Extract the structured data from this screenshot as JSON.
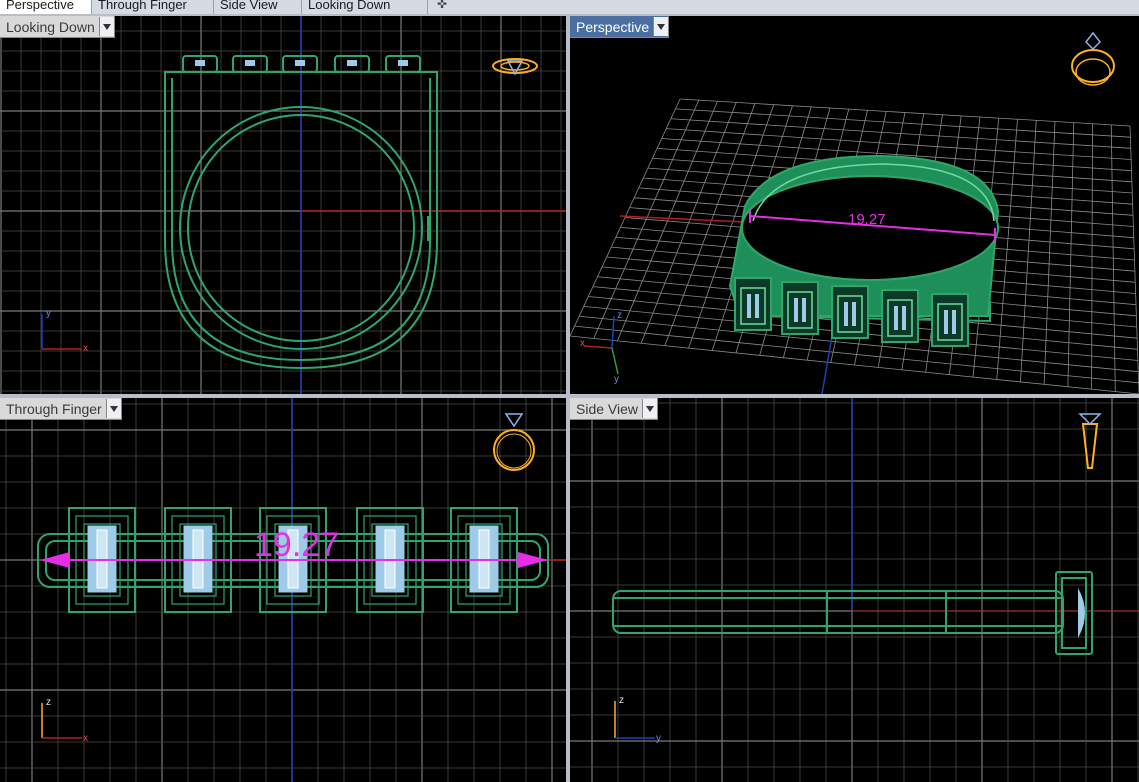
{
  "tabs": [
    {
      "label": "Perspective",
      "active": true
    },
    {
      "label": "Through Finger",
      "active": false
    },
    {
      "label": "Side View",
      "active": false
    },
    {
      "label": "Looking Down",
      "active": false
    }
  ],
  "add_tab_icon": "plus-icon",
  "viewports": {
    "top_left": {
      "title": "Looking Down",
      "axes": [
        "y",
        "x"
      ]
    },
    "top_right": {
      "title": "Perspective",
      "dimension": "19.27",
      "axes": [
        "z",
        "x",
        "y"
      ]
    },
    "bottom_left": {
      "title": "Through Finger",
      "dimension": "19.27",
      "axes": [
        "z",
        "x"
      ]
    },
    "bottom_right": {
      "title": "Side View",
      "axes": [
        "z",
        "y"
      ]
    }
  },
  "colors": {
    "model_green": "#2ea66b",
    "gem_blue": "#9ecbe8",
    "dimension_magenta": "#e62ee6",
    "axis_red": "#b41e1e",
    "axis_blue": "#1f3fb5",
    "axis_green": "#2ca02c",
    "grid": "#555555",
    "grid_major": "#7a7a7a",
    "active_label": "#4a6fa0",
    "widget_gold": "#ffb020"
  }
}
